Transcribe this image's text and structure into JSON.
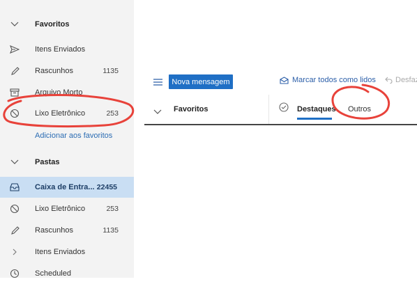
{
  "sidebar": {
    "favorites_header": "Favoritos",
    "favorites": [
      {
        "label": "Itens Enviados",
        "count": "",
        "icon": "send-icon"
      },
      {
        "label": "Rascunhos",
        "count": "1135",
        "icon": "pencil-icon"
      },
      {
        "label": "Arquivo Morto",
        "count": "",
        "icon": "archive-icon"
      },
      {
        "label": "Lixo Eletrônico",
        "count": "253",
        "icon": "block-icon"
      }
    ],
    "add_favorites": "Adicionar aos favoritos",
    "folders_header": "Pastas",
    "folders": [
      {
        "label": "Caixa de Entra...",
        "count": "22455",
        "icon": "inbox-icon",
        "selected": true
      },
      {
        "label": "Lixo Eletrônico",
        "count": "253",
        "icon": "block-icon"
      },
      {
        "label": "Rascunhos",
        "count": "1135",
        "icon": "pencil-icon"
      },
      {
        "label": "Itens Enviados",
        "count": "",
        "icon": "chevron-right-icon"
      },
      {
        "label": "Scheduled",
        "count": "",
        "icon": "clock-icon"
      }
    ]
  },
  "toolbar": {
    "new_message": "Nova mensagem",
    "mark_all_read": "Marcar todos como lidos",
    "undo": "Desfaz",
    "favorites": "Favoritos",
    "tabs": [
      {
        "label": "Destaques",
        "active": true
      },
      {
        "label": "Outros",
        "active": false
      }
    ]
  },
  "colors": {
    "accent": "#1f6fc5",
    "selected_bg": "#c9def3",
    "annotation": "#e8423a"
  }
}
